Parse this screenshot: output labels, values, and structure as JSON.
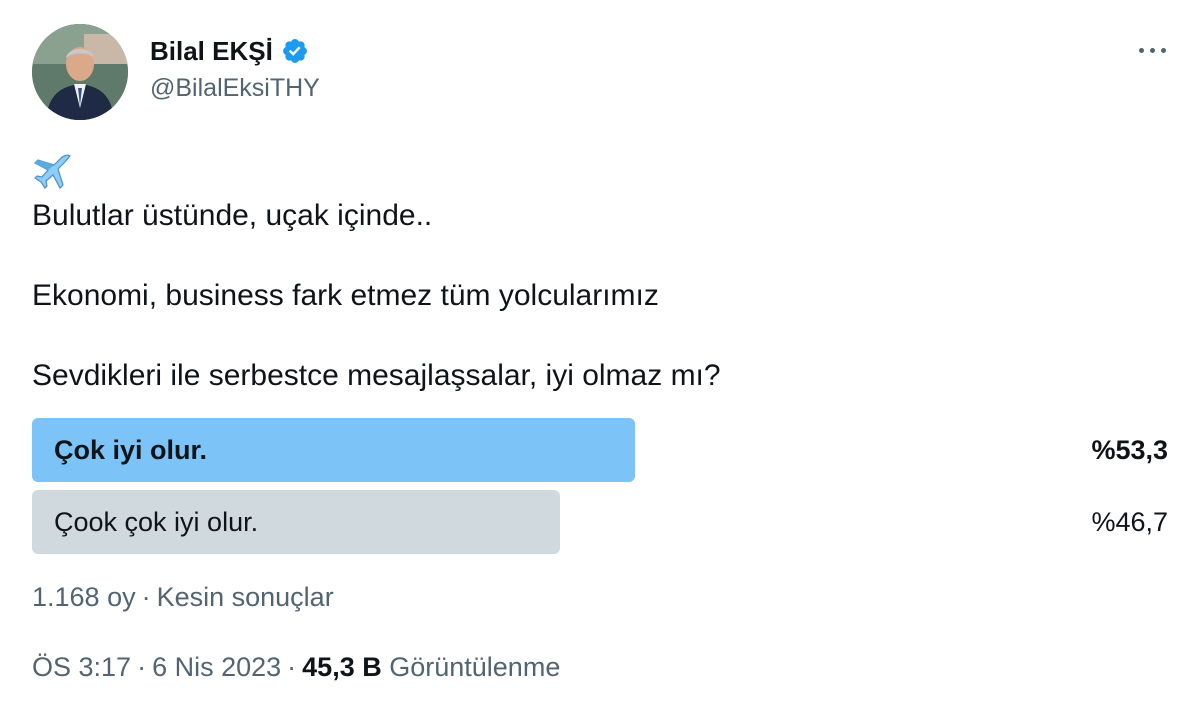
{
  "author": {
    "display_name": "Bilal EKŞİ",
    "handle": "@BilalEksiTHY",
    "verified": true,
    "verified_icon": "verified-badge-icon",
    "avatar_icon": "profile-photo"
  },
  "menu": {
    "icon": "more-horizontal-icon"
  },
  "tweet": {
    "emoji": "airplane-emoji",
    "lines": [
      "Bulutlar üstünde, uçak içinde..",
      "Ekonomi, business fark etmez tüm yolcularımız",
      "Sevdikleri ile serbestce mesajlaşsalar, iyi olmaz mı?"
    ]
  },
  "poll": {
    "options": [
      {
        "label": "Çok iyi olur.",
        "percent_label": "%53,3",
        "percent": 53.3,
        "winner": true
      },
      {
        "label": "Çook çok iyi olur.",
        "percent_label": "%46,7",
        "percent": 46.7,
        "winner": false
      }
    ],
    "votes": "1.168 oy",
    "status": "Kesin sonuçlar"
  },
  "meta": {
    "time": "ÖS 3:17",
    "date": "6 Nis 2023",
    "views_count": "45,3 B",
    "views_label": "Görüntülenme"
  },
  "colors": {
    "winner_bar": "#7cc3f7",
    "other_bar": "#cfd9de",
    "verified": "#1d9bf0",
    "secondary_text": "#536471"
  }
}
